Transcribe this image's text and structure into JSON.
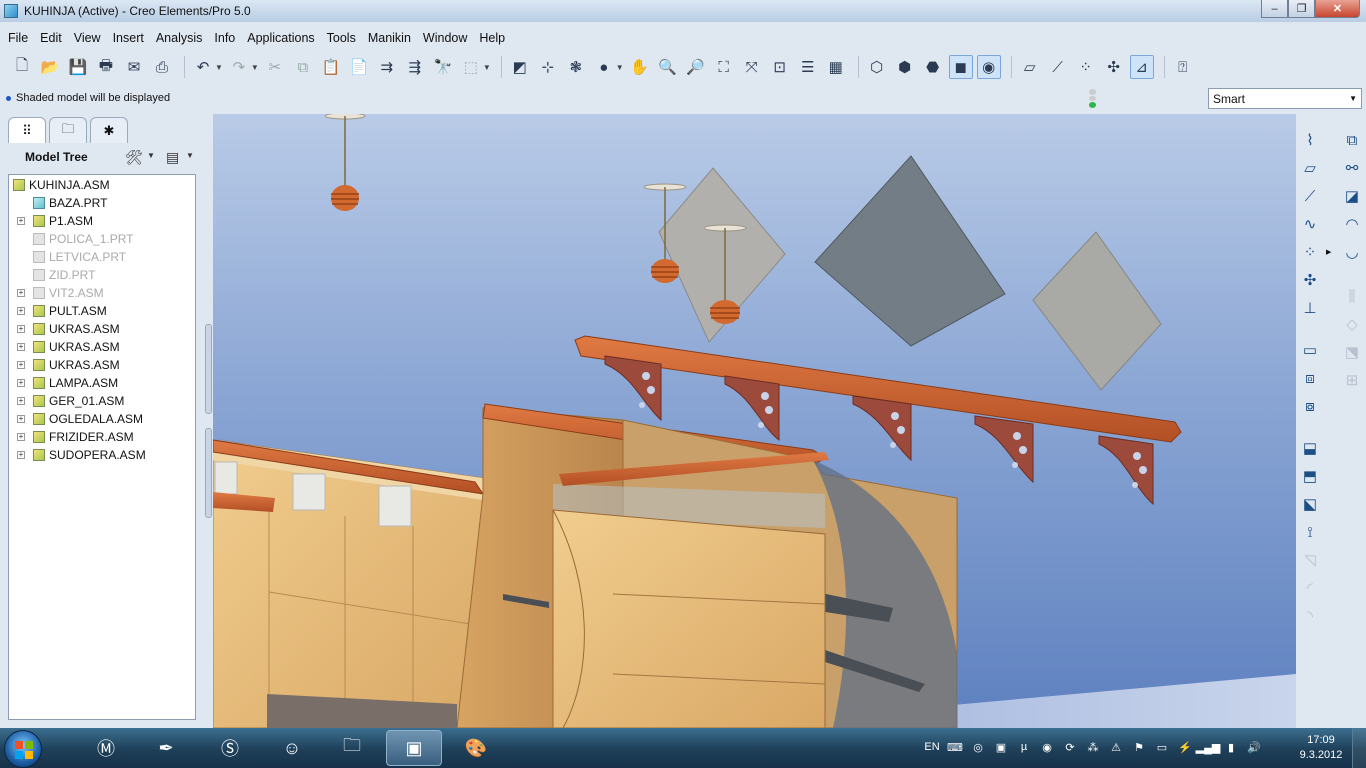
{
  "window": {
    "title": "KUHINJA (Active) - Creo Elements/Pro 5.0",
    "minimize": "–",
    "maximize": "❐",
    "close": "✕"
  },
  "menu": [
    "File",
    "Edit",
    "View",
    "Insert",
    "Analysis",
    "Info",
    "Applications",
    "Tools",
    "Manikin",
    "Window",
    "Help"
  ],
  "message": {
    "text": "Shaded model will be displayed"
  },
  "filter": {
    "value": "Smart"
  },
  "model_tree": {
    "title": "Model Tree",
    "items": [
      {
        "label": "KUHINJA.ASM",
        "type": "asm",
        "dimmed": false,
        "expandable": false,
        "root": true
      },
      {
        "label": "BAZA.PRT",
        "type": "prt",
        "dimmed": false,
        "expandable": false
      },
      {
        "label": "P1.ASM",
        "type": "asm",
        "dimmed": false,
        "expandable": true
      },
      {
        "label": "POLICA_1.PRT",
        "type": "prt",
        "dimmed": true,
        "expandable": false
      },
      {
        "label": "LETVICA.PRT",
        "type": "prt",
        "dimmed": true,
        "expandable": false
      },
      {
        "label": "ZID.PRT",
        "type": "prt",
        "dimmed": true,
        "expandable": false
      },
      {
        "label": "VIT2.ASM",
        "type": "asm",
        "dimmed": true,
        "expandable": true
      },
      {
        "label": "PULT.ASM",
        "type": "asm",
        "dimmed": false,
        "expandable": true
      },
      {
        "label": "UKRAS.ASM",
        "type": "asm",
        "dimmed": false,
        "expandable": true
      },
      {
        "label": "UKRAS.ASM",
        "type": "asm",
        "dimmed": false,
        "expandable": true
      },
      {
        "label": "UKRAS.ASM",
        "type": "asm",
        "dimmed": false,
        "expandable": true
      },
      {
        "label": "LAMPA.ASM",
        "type": "asm",
        "dimmed": false,
        "expandable": true
      },
      {
        "label": "GER_01.ASM",
        "type": "asm",
        "dimmed": false,
        "expandable": true
      },
      {
        "label": "OGLEDALA.ASM",
        "type": "asm",
        "dimmed": false,
        "expandable": true
      },
      {
        "label": "FRIZIDER.ASM",
        "type": "asm",
        "dimmed": false,
        "expandable": true
      },
      {
        "label": "SUDOPERA.ASM",
        "type": "asm",
        "dimmed": false,
        "expandable": true
      }
    ]
  },
  "taskbar": {
    "language": "EN",
    "time": "17:09",
    "date": "9.3.2012"
  }
}
